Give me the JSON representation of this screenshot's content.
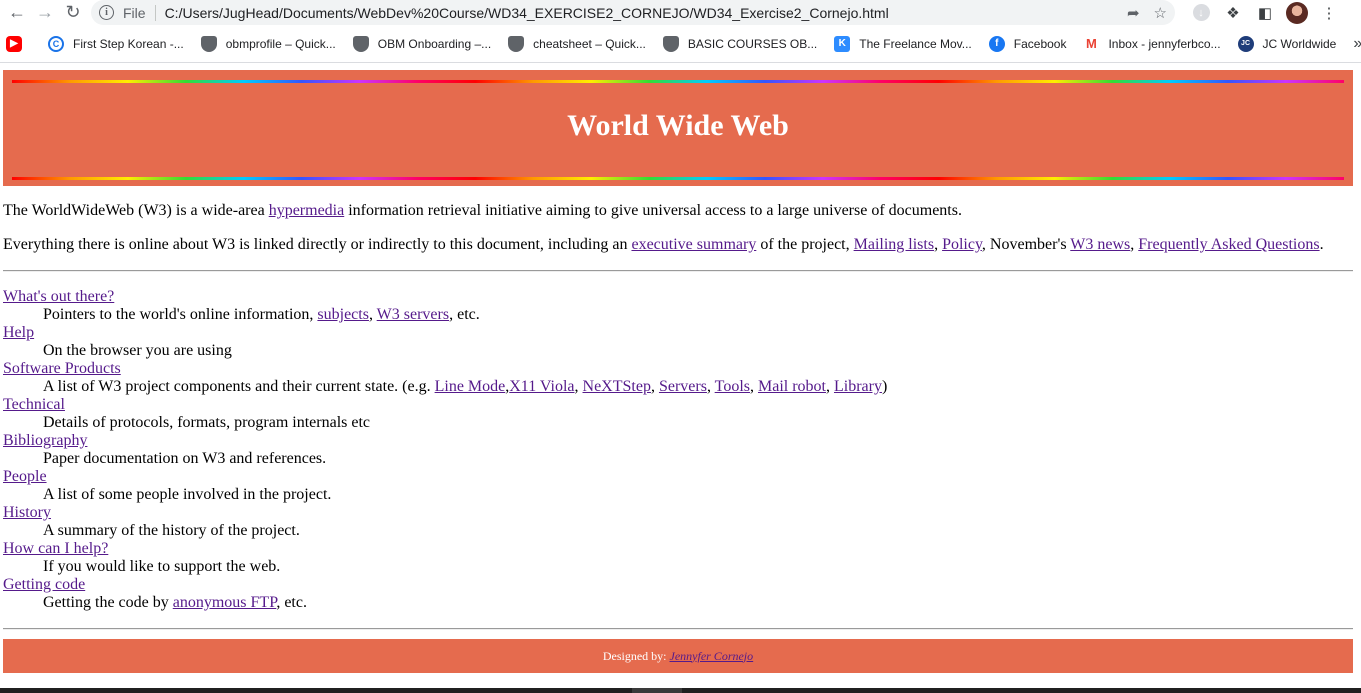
{
  "browser": {
    "file_label": "File",
    "url": "C:/Users/JugHead/Documents/WebDev%20Course/WD34_EXERCISE2_CORNEJO/WD34_Exercise2_Cornejo.html",
    "bookmarks": [
      {
        "label": "First Step Korean -...",
        "icon": "c-icon"
      },
      {
        "label": "obmprofile – Quick...",
        "icon": "shield-icon"
      },
      {
        "label": "OBM Onboarding –...",
        "icon": "shield-icon"
      },
      {
        "label": "cheatsheet – Quick...",
        "icon": "shield-icon"
      },
      {
        "label": "BASIC COURSES OB...",
        "icon": "shield-icon"
      },
      {
        "label": "The Freelance Mov...",
        "icon": "k-icon"
      },
      {
        "label": "Facebook",
        "icon": "facebook-icon"
      },
      {
        "label": "Inbox - jennyferbco...",
        "icon": "gmail-icon"
      },
      {
        "label": "JC Worldwide",
        "icon": "jc-icon"
      }
    ]
  },
  "header": {
    "title": "World Wide Web"
  },
  "intro": {
    "p1_before": "The WorldWideWeb (W3) is a wide-area ",
    "p1_link": "hypermedia",
    "p1_after": " information retrieval initiative aiming to give universal access to a large universe of documents.",
    "p2_before": "Everything there is online about W3 is linked directly or indirectly to this document, including an ",
    "p2_link1": "executive summary",
    "p2_mid1": " of the project, ",
    "p2_link2": "Mailing lists",
    "p2_sep1": ", ",
    "p2_link3": "Policy",
    "p2_mid2": ", November's ",
    "p2_link4": "W3 news",
    "p2_sep2": ", ",
    "p2_link5": "Frequently Asked Questions",
    "p2_end": "."
  },
  "topics": {
    "t1": {
      "term": "What's out there?",
      "d_before": "Pointers to the world's online information, ",
      "l1": "subjects",
      "s1": ", ",
      "l2": "W3 servers",
      "d_after": ", etc."
    },
    "t2": {
      "term": "Help",
      "desc": "On the browser you are using"
    },
    "t3": {
      "term": "Software Products",
      "d_before": "A list of W3 project components and their current state. (e.g. ",
      "l1": "Line Mode",
      "s1": ",",
      "l2": "X11 Viola",
      "s2": ", ",
      "l3": "NeXTStep",
      "s3": ", ",
      "l4": "Servers",
      "s4": ", ",
      "l5": "Tools",
      "s5": ", ",
      "l6": "Mail robot",
      "s6": ", ",
      "l7": "Library",
      "d_after": ")"
    },
    "t4": {
      "term": "Technical",
      "desc": "Details of protocols, formats, program internals etc"
    },
    "t5": {
      "term": "Bibliography",
      "desc": "Paper documentation on W3 and references."
    },
    "t6": {
      "term": "People",
      "desc": "A list of some people involved in the project."
    },
    "t7": {
      "term": "History",
      "desc": "A summary of the history of the project."
    },
    "t8": {
      "term": "How can I help?",
      "desc": "If you would like to support the web."
    },
    "t9": {
      "term": "Getting code",
      "d_before": "Getting the code by ",
      "l1": "anonymous FTP",
      "d_after": ", etc."
    }
  },
  "footer": {
    "label": "Designed by:",
    "author": "Jennyfer Cornejo"
  },
  "colors": {
    "banner": "#e56b4e",
    "link": "#551a8b"
  }
}
